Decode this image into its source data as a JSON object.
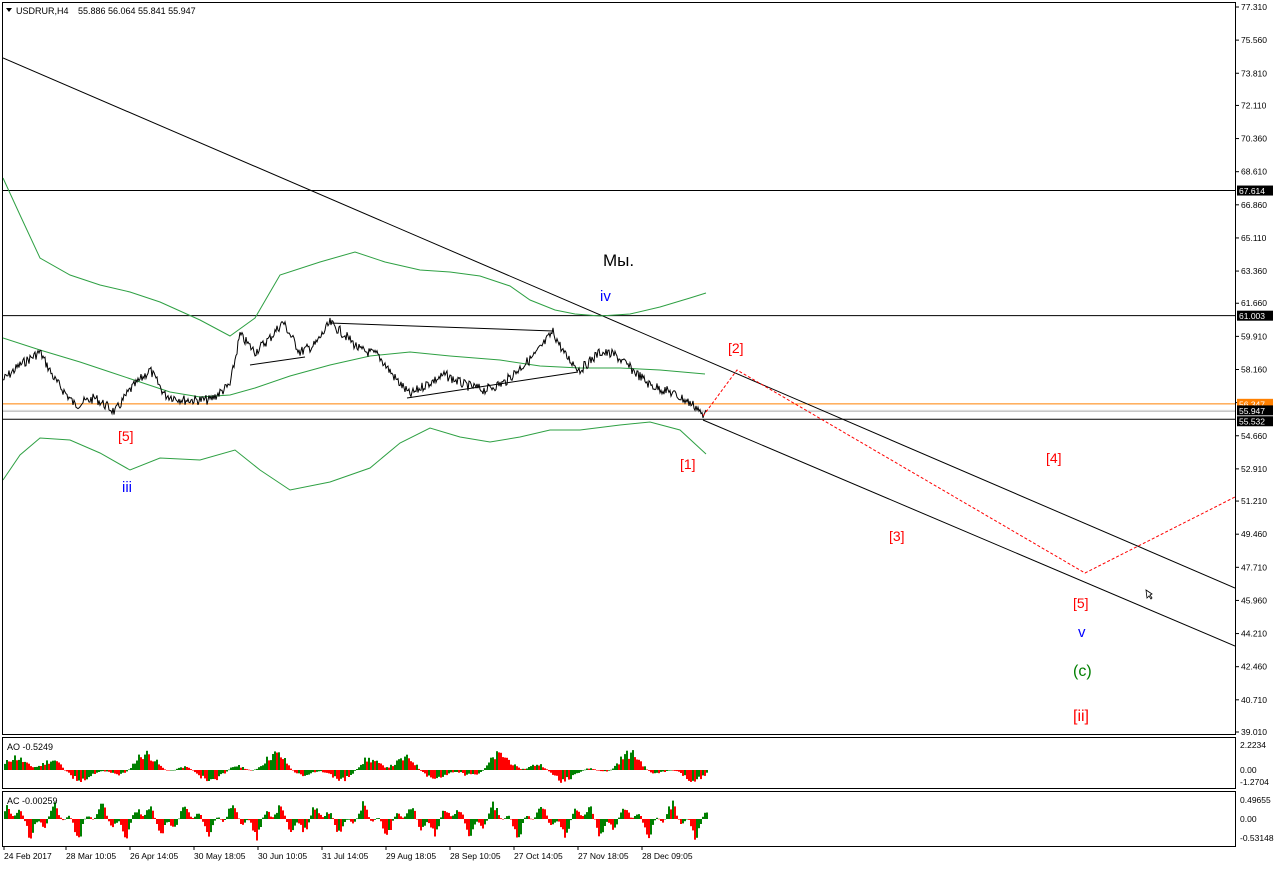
{
  "header": {
    "symbol_label": "USDRUR,H4",
    "ohlc_text": "55.886 56.064 55.841 55.947"
  },
  "price_axis": {
    "ticks": [
      "77.310",
      "75.560",
      "73.810",
      "72.110",
      "70.360",
      "68.610",
      "66.860",
      "65.110",
      "63.360",
      "61.660",
      "59.910",
      "58.160",
      "56.410",
      "54.660",
      "52.910",
      "51.210",
      "49.460",
      "47.710",
      "45.960",
      "44.210",
      "42.460",
      "40.710",
      "39.010"
    ],
    "tick_values": [
      77.31,
      75.56,
      73.81,
      72.11,
      70.36,
      68.61,
      66.86,
      65.11,
      63.36,
      61.66,
      59.91,
      58.16,
      56.41,
      54.66,
      52.91,
      51.21,
      49.46,
      47.71,
      45.96,
      44.21,
      42.46,
      40.71,
      39.01
    ],
    "ylim": [
      38.93,
      77.72
    ],
    "price_boxes": [
      {
        "label": "67.614",
        "value": 67.614,
        "color": "#000000"
      },
      {
        "label": "61.003",
        "value": 61.003,
        "color": "#000000"
      },
      {
        "label": "56.347",
        "value": 56.347,
        "color": "#ff8000"
      },
      {
        "label": "55.947",
        "value": 55.947,
        "color": "#000000"
      },
      {
        "label": "55.532",
        "value": 55.532,
        "color": "#000000"
      }
    ]
  },
  "time_axis": {
    "labels": [
      "24 Feb 2017",
      "28 Mar 10:05",
      "26 Apr 14:05",
      "30 May 18:05",
      "30 Jun 10:05",
      "31 Jul 14:05",
      "29 Aug 18:05",
      "28 Sep 10:05",
      "27 Oct 14:05",
      "27 Nov 18:05",
      "28 Dec 09:05"
    ]
  },
  "chart_data": [
    {
      "type": "line",
      "title": "USDRUR,H4",
      "series_summary": "price path (approx. from visible turns)",
      "x": [
        "24 Feb 2017",
        "28 Mar 10:05",
        "26 Apr 14:05",
        "30 May 18:05",
        "30 Jun 10:05",
        "31 Jul 14:05",
        "29 Aug 18:05",
        "28 Sep 10:05",
        "27 Oct 14:05",
        "27 Nov 18:05",
        "28 Dec 09:05"
      ],
      "series": [
        {
          "name": "",
          "values": [
            58.2,
            56.1,
            57.2,
            59.6,
            59.4,
            59.7,
            57.1,
            57.5,
            58.5,
            59.6,
            57.3
          ]
        }
      ],
      "horizontal_levels": [
        67.614,
        61.003,
        56.347,
        55.947,
        55.532
      ],
      "ylim": [
        38.93,
        77.72
      ]
    },
    {
      "type": "bar",
      "title": "AO -0.5249",
      "ylim": [
        -1.2704,
        2.2234
      ],
      "ticks": [
        "2.2234",
        "0.00",
        "-1.2704"
      ]
    },
    {
      "type": "bar",
      "title": "AC -0.00259",
      "ylim": [
        -0.53148,
        0.49655
      ],
      "ticks": [
        "0.49655",
        "0.00",
        "-0.53148"
      ]
    }
  ],
  "annotations": {
    "my": "Мы.",
    "iv": "iv",
    "iii": "iii",
    "w5_left": "[5]",
    "w2": "[2]",
    "w1": "[1]",
    "w3": "[3]",
    "w4": "[4]",
    "w5_right": "[5]",
    "v": "v",
    "c": "(c)",
    "ii": "[ii]"
  },
  "indicators": {
    "ao": {
      "label": "AO -0.5249",
      "ticks": [
        "2.2234",
        "0.00",
        "-1.2704"
      ]
    },
    "ac": {
      "label": "AC -0.00259",
      "ticks": [
        "0.49655",
        "0.00",
        "-0.53148"
      ]
    }
  },
  "colors": {
    "price_line": "#000000",
    "envelope": "#2ea043",
    "highlight_level": "#ff8000",
    "projection": "#ff0000",
    "label_red": "#ff0000",
    "label_blue": "#0000ff",
    "label_green": "#008000",
    "bar_up": "#008000",
    "bar_down": "#ff0000"
  }
}
